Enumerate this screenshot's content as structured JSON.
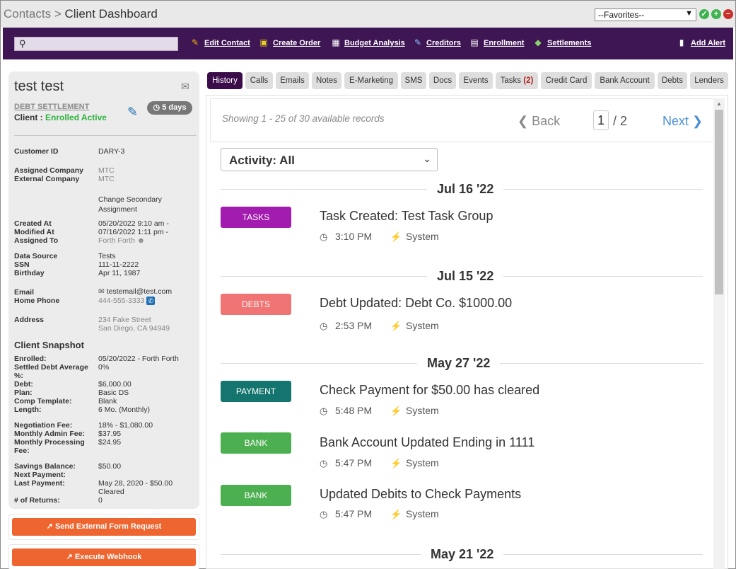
{
  "breadcrumb": {
    "parent": "Contacts",
    "separator": ">",
    "current": "Client Dashboard"
  },
  "favorites": {
    "selected": "--Favorites--"
  },
  "toolbar": {
    "links": [
      {
        "label": "Edit Contact",
        "icon": "edit-contact-icon",
        "color": "#f0b400"
      },
      {
        "label": "Create Order",
        "icon": "cube-icon",
        "color": "#e8d01f"
      },
      {
        "label": "Budget Analysis",
        "icon": "calculator-icon",
        "color": "#ffffff"
      },
      {
        "label": "Creditors",
        "icon": "notepad-icon",
        "color": "#7fc3ff"
      },
      {
        "label": "Enrollment",
        "icon": "document-icon",
        "color": "#ffffff"
      },
      {
        "label": "Settlements",
        "icon": "money-icon",
        "color": "#8bd36b"
      }
    ],
    "alert": {
      "label": "Add Alert",
      "icon": "speech-bubble-icon"
    }
  },
  "client": {
    "name": "test test",
    "program": "DEBT SETTLEMENT",
    "status_label": "Client :",
    "status_value": "Enrolled Active",
    "days": "5 days",
    "details": {
      "customer_id_label": "Customer ID",
      "customer_id": "DARY-3",
      "assigned_company_label": "Assigned Company",
      "assigned_company": "MTC",
      "external_company_label": "External Company",
      "external_company": "MTC",
      "change_secondary": "Change Secondary Assignment",
      "created_at_label": "Created At",
      "created_at": "05/20/2022 9:10 am -",
      "modified_at_label": "Modified At",
      "modified_at": "07/16/2022 1:11 pm -",
      "assigned_to_label": "Assigned To",
      "assigned_to": "Forth Forth",
      "data_source_label": "Data Source",
      "data_source": "Tests",
      "ssn_label": "SSN",
      "ssn": "111-11-2222",
      "birthday_label": "Birthday",
      "birthday": "Apr 11, 1987",
      "email_label": "Email",
      "email": "testemail@test.com",
      "home_phone_label": "Home Phone",
      "home_phone": "444-555-3333",
      "address_label": "Address",
      "address_line1": "234 Fake Street",
      "address_line2": "San Diego, CA 94949"
    },
    "snapshot": {
      "title": "Client Snapshot",
      "enrolled_label": "Enrolled:",
      "enrolled": "05/20/2022 - Forth Forth",
      "settled_label": "Settled Debt Average %:",
      "settled": "0%",
      "debt_label": "Debt:",
      "debt": "$6,000.00",
      "plan_label": "Plan:",
      "plan": "Basic DS",
      "comp_label": "Comp Template:",
      "comp": "Blank",
      "length_label": "Length:",
      "length": "6 Mo. (Monthly)",
      "neg_fee_label": "Negotiation Fee:",
      "neg_fee": "18% - $1,080.00",
      "admin_fee_label": "Monthly Admin Fee:",
      "admin_fee": "$37.95",
      "proc_fee_label": "Monthly Processing Fee:",
      "proc_fee": "$24.95",
      "savings_label": "Savings Balance:",
      "savings": "$50.00",
      "next_payment_label": "Next Payment:",
      "last_payment_label": "Last Payment:",
      "last_payment": "May 28, 2020 - $50.00",
      "last_payment_status": "Cleared",
      "returns_label": "# of Returns:",
      "returns": "0"
    }
  },
  "actions": {
    "external_form": "Send External Form Request",
    "webhook": "Execute Webhook"
  },
  "tabs": [
    {
      "label": "History",
      "active": true
    },
    {
      "label": "Calls"
    },
    {
      "label": "Emails"
    },
    {
      "label": "Notes"
    },
    {
      "label": "E-Marketing"
    },
    {
      "label": "SMS"
    },
    {
      "label": "Docs"
    },
    {
      "label": "Events"
    },
    {
      "label": "Tasks",
      "count": "(2)"
    },
    {
      "label": "Credit Card"
    },
    {
      "label": "Bank Account"
    },
    {
      "label": "Debts"
    },
    {
      "label": "Lenders"
    }
  ],
  "pager": {
    "showing": "Showing 1 - 25 of 30 available records",
    "back": "Back",
    "page": "1",
    "total": "/ 2",
    "next": "Next"
  },
  "filter": {
    "label": "Activity: All"
  },
  "history": [
    {
      "date": "Jul 16 '22",
      "entries": [
        {
          "tag": "TASKS",
          "color": "#a21caf",
          "title": "Task Created:  Test Task Group",
          "time": "3:10 PM",
          "source": "System"
        }
      ]
    },
    {
      "date": "Jul 15 '22",
      "entries": [
        {
          "tag": "DEBTS",
          "color": "#f07474",
          "title": "Debt Updated: Debt Co. $1000.00",
          "time": "2:53 PM",
          "source": "System"
        }
      ]
    },
    {
      "date": "May 27 '22",
      "entries": [
        {
          "tag": "PAYMENT",
          "color": "#13756d",
          "title": "Check Payment for $50.00 has cleared",
          "time": "5:48 PM",
          "source": "System"
        },
        {
          "tag": "BANK",
          "color": "#4caf50",
          "title": "Bank Account Updated Ending in 1111",
          "time": "5:47 PM",
          "source": "System"
        },
        {
          "tag": "BANK",
          "color": "#4caf50",
          "title": "Updated Debits to Check Payments",
          "time": "5:47 PM",
          "source": "System"
        }
      ]
    },
    {
      "date": "May 21 '22",
      "entries": []
    }
  ]
}
